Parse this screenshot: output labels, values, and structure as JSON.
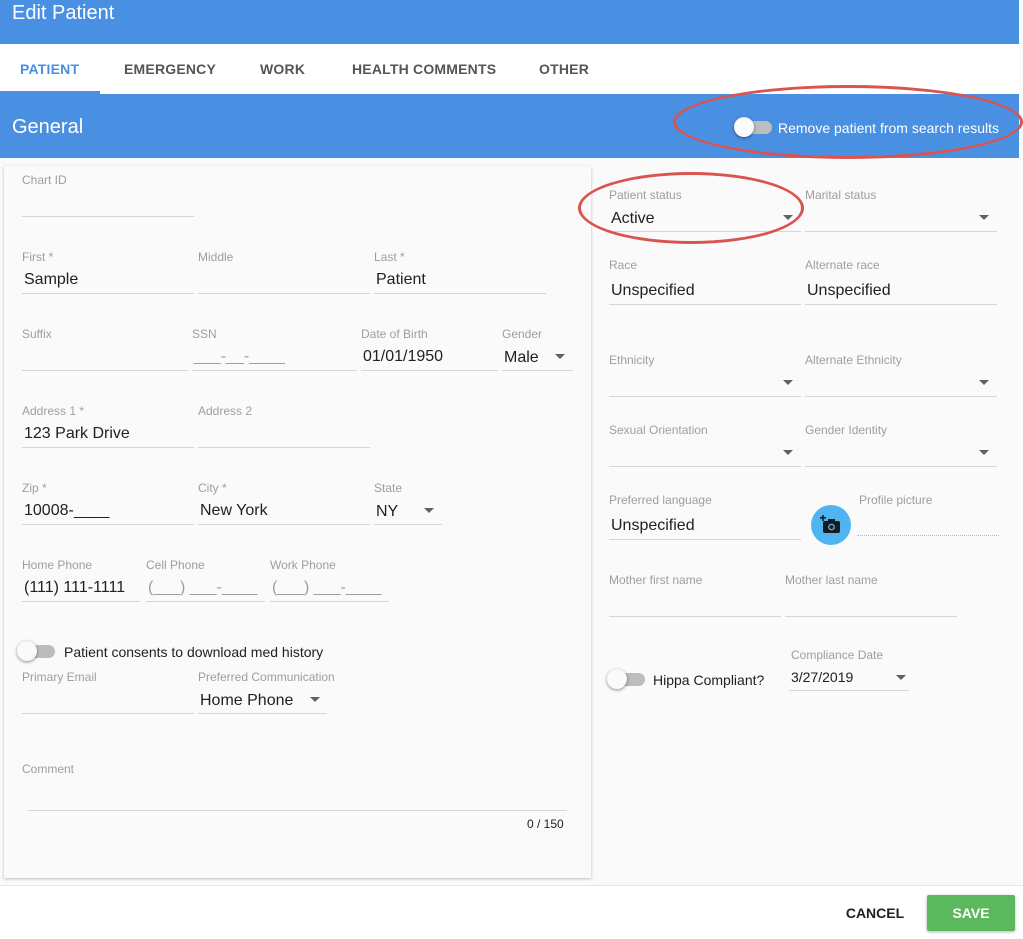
{
  "header": {
    "title": "Edit Patient"
  },
  "tabs": [
    {
      "label": "PATIENT"
    },
    {
      "label": "EMERGENCY"
    },
    {
      "label": "WORK"
    },
    {
      "label": "HEALTH COMMENTS"
    },
    {
      "label": "OTHER"
    }
  ],
  "section": {
    "title": "General",
    "remove_toggle_label": "Remove patient from search results"
  },
  "left": {
    "chart_id": {
      "label": "Chart ID",
      "value": ""
    },
    "first": {
      "label": "First *",
      "value": "Sample"
    },
    "middle": {
      "label": "Middle",
      "value": ""
    },
    "last": {
      "label": "Last *",
      "value": "Patient"
    },
    "suffix": {
      "label": "Suffix",
      "value": ""
    },
    "ssn": {
      "label": "SSN",
      "placeholder": "___-__-____"
    },
    "dob": {
      "label": "Date of Birth",
      "value": "01/01/1950"
    },
    "gender": {
      "label": "Gender",
      "value": "Male"
    },
    "address1": {
      "label": "Address 1 *",
      "value": "123 Park Drive"
    },
    "address2": {
      "label": "Address 2",
      "value": ""
    },
    "zip": {
      "label": "Zip *",
      "value": "10008-____"
    },
    "city": {
      "label": "City *",
      "value": "New York"
    },
    "state": {
      "label": "State",
      "value": "NY"
    },
    "home_phone": {
      "label": "Home Phone",
      "value": "(111) 111-1111"
    },
    "cell_phone": {
      "label": "Cell Phone",
      "placeholder": "(___) ___-____"
    },
    "work_phone": {
      "label": "Work Phone",
      "placeholder": "(___) ___-____"
    },
    "consent_label": "Patient consents to download med history",
    "primary_email": {
      "label": "Primary Email",
      "value": ""
    },
    "preferred_comm": {
      "label": "Preferred Communication",
      "value": "Home Phone"
    },
    "comment": {
      "label": "Comment",
      "counter": "0 / 150"
    }
  },
  "right": {
    "patient_status": {
      "label": "Patient status",
      "value": "Active"
    },
    "marital_status": {
      "label": "Marital status",
      "value": ""
    },
    "race": {
      "label": "Race",
      "value": "Unspecified"
    },
    "alt_race": {
      "label": "Alternate race",
      "value": "Unspecified"
    },
    "ethnicity": {
      "label": "Ethnicity"
    },
    "alt_ethnicity": {
      "label": "Alternate Ethnicity"
    },
    "sexual_orientation": {
      "label": "Sexual Orientation"
    },
    "gender_identity": {
      "label": "Gender Identity"
    },
    "preferred_language": {
      "label": "Preferred language",
      "value": "Unspecified"
    },
    "profile_picture": {
      "label": "Profile picture"
    },
    "mother_first": {
      "label": "Mother first name"
    },
    "mother_last": {
      "label": "Mother last name"
    },
    "hippa_label": "Hippa Compliant?",
    "compliance_date": {
      "label": "Compliance Date",
      "value": "3/27/2019"
    }
  },
  "footer": {
    "cancel": "CANCEL",
    "save": "SAVE"
  },
  "colors": {
    "primary": "#4a90e2",
    "save": "#5cb85c",
    "highlight": "#d9534f"
  },
  "icons": {
    "camera": "add-a-photo-icon",
    "dropdown": "chevron-down-icon"
  }
}
